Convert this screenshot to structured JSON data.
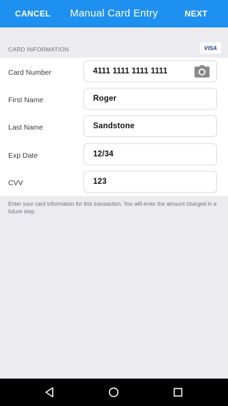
{
  "topbar": {
    "cancel_label": "CANCEL",
    "title": "Manual Card Entry",
    "next_label": "NEXT",
    "background_color": "#1e90f0"
  },
  "section": {
    "header": "CARD INFORMATION",
    "card_brand": "VISA"
  },
  "fields": [
    {
      "label": "Card Number",
      "value": "4111 1111 1111 1111",
      "icon": "camera-icon"
    },
    {
      "label": "First Name",
      "value": "Roger"
    },
    {
      "label": "Last Name",
      "value": "Sandstone"
    },
    {
      "label": "Exp Date",
      "value": "12/34"
    },
    {
      "label": "CVV",
      "value": "123"
    }
  ],
  "hint": "Enter your card information for this transaction. You will enter the amount charged in a future step.",
  "navbar": {
    "icons": [
      "back-icon",
      "home-icon",
      "recents-icon"
    ]
  }
}
